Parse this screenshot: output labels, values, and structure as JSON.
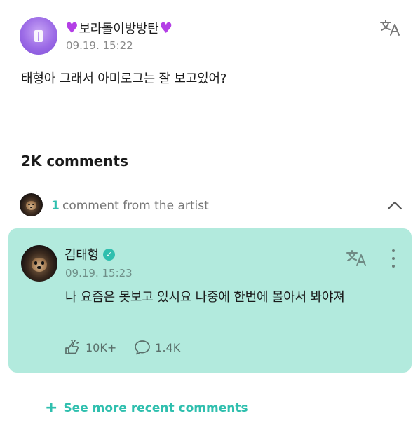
{
  "post": {
    "author_name": "보라돌이방방탄",
    "author_prefix_icon": "purple-heart",
    "author_suffix_icon": "purple-heart",
    "timestamp": "09.19. 15:22",
    "body": "태형아 그래서 아미로그는 잘 보고있어?",
    "translate_icon": "translate-icon"
  },
  "comments": {
    "count_label": "2K comments",
    "artist_summary": {
      "count": "1",
      "label": "comment from the artist",
      "toggle_icon": "chevron-up-icon"
    },
    "artist_comment": {
      "author_name": "김태형",
      "verified_icon": "verified-badge-icon",
      "timestamp": "09.19. 15:23",
      "text": "나 요즘은 못보고 있시요 나중에 한번에 몰아서 봐야져",
      "likes": "10K+",
      "replies": "1.4K",
      "translate_icon": "translate-icon",
      "more_icon": "more-vertical-icon"
    },
    "see_more_label": "See more recent comments"
  },
  "colors": {
    "accent": "#2fbfae",
    "artist_card_bg": "#b2eadd",
    "heart": "#b43fe6"
  }
}
